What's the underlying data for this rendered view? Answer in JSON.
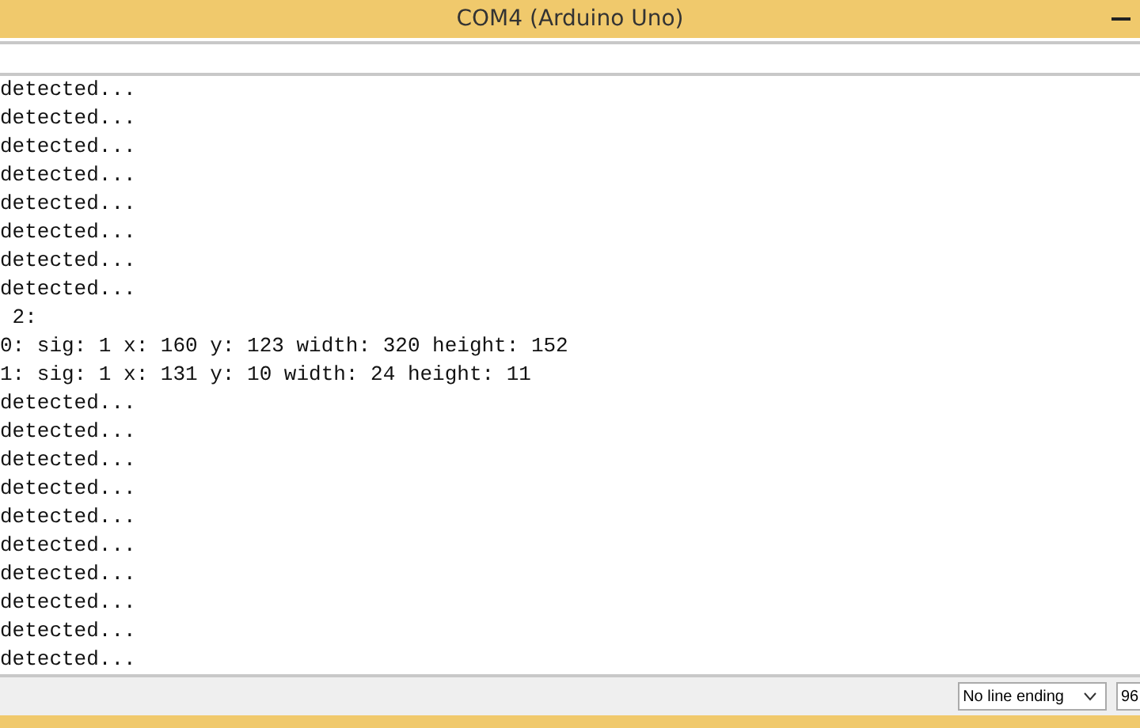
{
  "window": {
    "title": "COM4 (Arduino Uno)"
  },
  "output_lines": [
    "detected...",
    "detected...",
    "detected...",
    "detected...",
    "detected...",
    "detected...",
    "detected...",
    "detected...",
    " 2:",
    "0: sig: 1 x: 160 y: 123 width: 320 height: 152",
    "1: sig: 1 x: 131 y: 10 width: 24 height: 11",
    "detected...",
    "detected...",
    "detected...",
    "detected...",
    "detected...",
    "detected...",
    "detected...",
    "detected...",
    "detected...",
    "detected..."
  ],
  "status_bar": {
    "line_ending": "No line ending",
    "baud_rate": "96"
  }
}
